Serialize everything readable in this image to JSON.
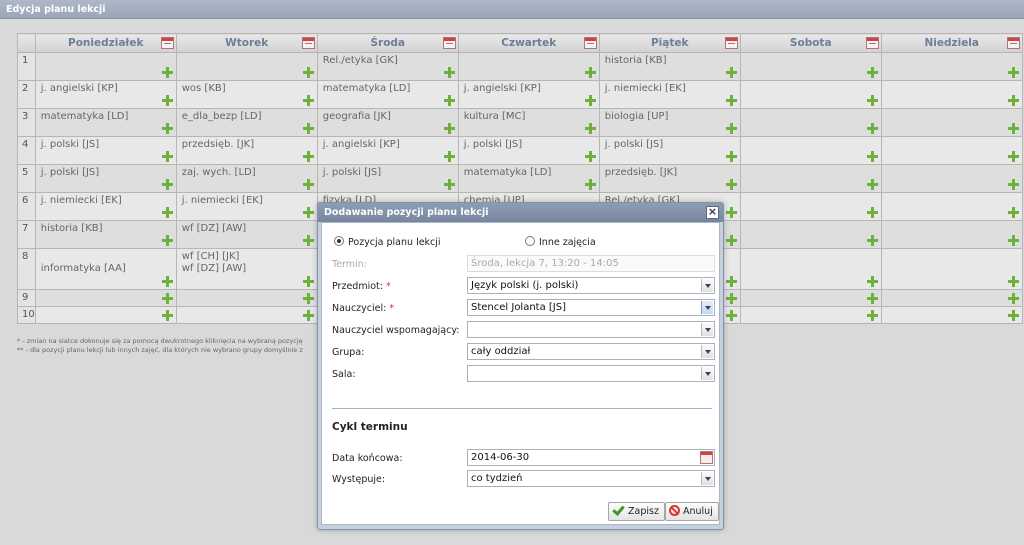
{
  "window": {
    "title": "Edycja planu lekcji"
  },
  "grid": {
    "days": [
      "Poniedziałek",
      "Wtorek",
      "Środa",
      "Czwartek",
      "Piątek",
      "Sobota",
      "Niedziela"
    ],
    "rows": [
      {
        "num": "1",
        "cells": [
          "",
          "",
          "Rel./etyka [GK]",
          "",
          "historia [KB]",
          "",
          ""
        ]
      },
      {
        "num": "2",
        "cells": [
          "j. angielski [KP]",
          "wos [KB]",
          "matematyka [LD]",
          "j. angielski [KP]",
          "j. niemiecki [EK]",
          "",
          ""
        ]
      },
      {
        "num": "3",
        "cells": [
          "matematyka [LD]",
          "e_dla_bezp [LD]",
          "geografia [JK]",
          "kultura [MC]",
          "biologia [UP]",
          "",
          ""
        ]
      },
      {
        "num": "4",
        "cells": [
          "j. polski [JS]",
          "przedsięb. [JK]",
          "j. angielski [KP]",
          "j. polski [JS]",
          "j. polski [JS]",
          "",
          ""
        ]
      },
      {
        "num": "5",
        "cells": [
          "j. polski [JS]",
          "zaj. wych. [LD]",
          "j. polski [JS]",
          "matematyka [LD]",
          "przedsięb. [JK]",
          "",
          ""
        ]
      },
      {
        "num": "6",
        "cells": [
          "j. niemiecki [EK]",
          "j. niemiecki [EK]",
          "fizyka [LD]",
          "chemia [UP]",
          "Rel./etyka [GK]",
          "",
          ""
        ]
      },
      {
        "num": "7",
        "cells": [
          "historia [KB]",
          "wf [DZ] [AW]",
          "",
          "",
          "",
          "",
          ""
        ]
      },
      {
        "num": "8",
        "cells": [
          "\ninformatyka [AA]",
          "wf [CH] [JK]\nwf [DZ] [AW]",
          "",
          "",
          "",
          "",
          ""
        ]
      },
      {
        "num": "9",
        "cells": [
          "",
          "",
          "",
          "",
          "",
          "",
          ""
        ]
      },
      {
        "num": "10",
        "cells": [
          "",
          "",
          "",
          "",
          "",
          "",
          ""
        ]
      }
    ]
  },
  "notes": {
    "line1": "* - zmian na siatce dokonuje się za pomocą dwukrotnego kliknięcia na wybraną pozycję",
    "line2": "** - dla pozycji planu lekcji lub innych zajęć, dla których nie wybrano grupy domyślnie z"
  },
  "dialog": {
    "title": "Dodawanie pozycji planu lekcji",
    "close_label": "×",
    "radio_lesson": "Pozycja planu lekcji",
    "radio_other": "Inne zajęcia",
    "term_label": "Termin:",
    "term_value": "Środa, lekcja 7, 13:20 - 14:05",
    "subject_label": "Przedmiot:",
    "subject_value": "Język polski (j. polski)",
    "teacher_label": "Nauczyciel:",
    "teacher_value": "Stencel Jolanta [JS]",
    "assistant_label": "Nauczyciel wspomagający:",
    "assistant_value": "",
    "group_label": "Grupa:",
    "group_value": "cały oddział",
    "room_label": "Sala:",
    "room_value": "",
    "required_mark": "*",
    "cycle_section": "Cykl terminu",
    "end_date_label": "Data końcowa:",
    "end_date_value": "2014-06-30",
    "occurs_label": "Występuje:",
    "occurs_value": "co tydzień",
    "save_label": "Zapisz",
    "cancel_label": "Anuluj"
  },
  "colors": {
    "add_icon": "#6bb13c",
    "required": "#e23333",
    "header_text": "#6b7f99"
  }
}
